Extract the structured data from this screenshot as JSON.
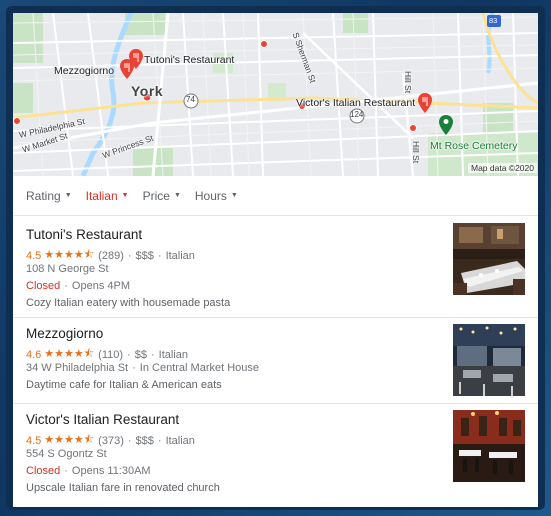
{
  "map": {
    "city_label": "York",
    "credit": "Map data ©2020",
    "labels": {
      "tutoni": "Tutoni's Restaurant",
      "mezzogiorno": "Mezzogiorno",
      "victors": "Victor's Italian Restaurant",
      "cemetery": "Mt Rose Cemetery",
      "philadelphia_st": "W Philadelphia St",
      "market_st": "W Market St",
      "princess_st": "W Princess St",
      "sherman_st": "S Sherman St",
      "hill_st_n": "Hill St",
      "hill_st_s": "Hill St",
      "route_74": "74",
      "route_124": "124",
      "route_83": "83"
    }
  },
  "filters": [
    {
      "label": "Rating",
      "active": false
    },
    {
      "label": "Italian",
      "active": true
    },
    {
      "label": "Price",
      "active": false
    },
    {
      "label": "Hours",
      "active": false
    }
  ],
  "results": [
    {
      "name": "Tutoni's Restaurant",
      "rating": "4.5",
      "stars": "★★★★⯪",
      "reviews": "(289)",
      "price": "$$$",
      "category": "Italian",
      "address": "108 N George St",
      "status": "Closed",
      "hours": "Opens 4PM",
      "description": "Cozy Italian eatery with housemade pasta"
    },
    {
      "name": "Mezzogiorno",
      "rating": "4.6",
      "stars": "★★★★⯪",
      "reviews": "(110)",
      "price": "$$",
      "category": "Italian",
      "address": "34 W Philadelphia St",
      "address_extra": "In Central Market House",
      "description": "Daytime cafe for Italian & American eats"
    },
    {
      "name": "Victor's Italian Restaurant",
      "rating": "4.5",
      "stars": "★★★★⯪",
      "reviews": "(373)",
      "price": "$$$",
      "category": "Italian",
      "address": "554 S Ogontz St",
      "status": "Closed",
      "hours": "Opens 11:30AM",
      "description": "Upscale Italian fare in renovated church"
    }
  ],
  "separator": "·",
  "colors": {
    "accent_red": "#d93025",
    "star_orange": "#e7711b",
    "map_pin_red": "#ea4335",
    "cemetery_green": "#188038"
  }
}
